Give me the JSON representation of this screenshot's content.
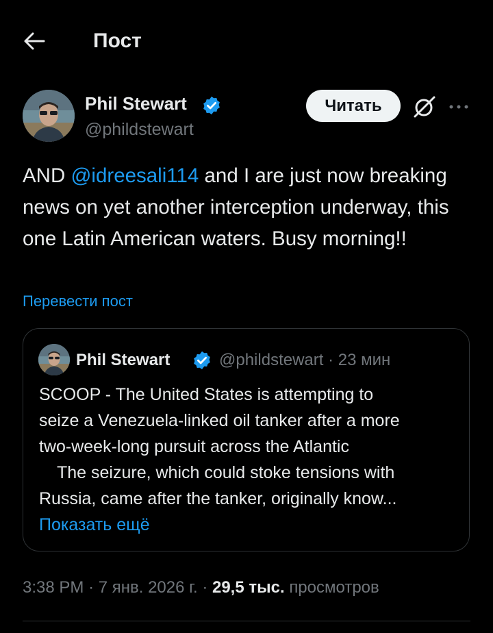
{
  "header": {
    "title": "Пост",
    "back_icon": "arrow-left-icon"
  },
  "author": {
    "name": "Phil Stewart",
    "handle": "@phildstewart",
    "verified": true
  },
  "follow_button": {
    "label": "Читать"
  },
  "tweet": {
    "prefix": "AND ",
    "mention": "@idreesali114",
    "body": " and I are just now breaking news on yet another interception underway, this one Latin American waters. Busy morning!!"
  },
  "translate_label": "Перевести пост",
  "quote": {
    "name": "Phil Stewart",
    "handle": "@phildstewart",
    "separator": "·",
    "time": "23 мин",
    "lines": [
      "SCOOP - The United States is attempting to",
      "seize a Venezuela-linked oil tanker after a more",
      "two-week-long pursuit across the Atlantic",
      "The seizure, which could stoke tensions with",
      "Russia, came after the tanker, originally know..."
    ],
    "show_more": "Показать ещё"
  },
  "meta": {
    "time": "3:38 PM",
    "date": "7 янв. 2026 г.",
    "separator": "·",
    "views_count": "29,5 тыс.",
    "views_label": "просмотров"
  },
  "colors": {
    "accent": "#1d9bf0",
    "background": "#000000",
    "muted": "#71767b"
  }
}
